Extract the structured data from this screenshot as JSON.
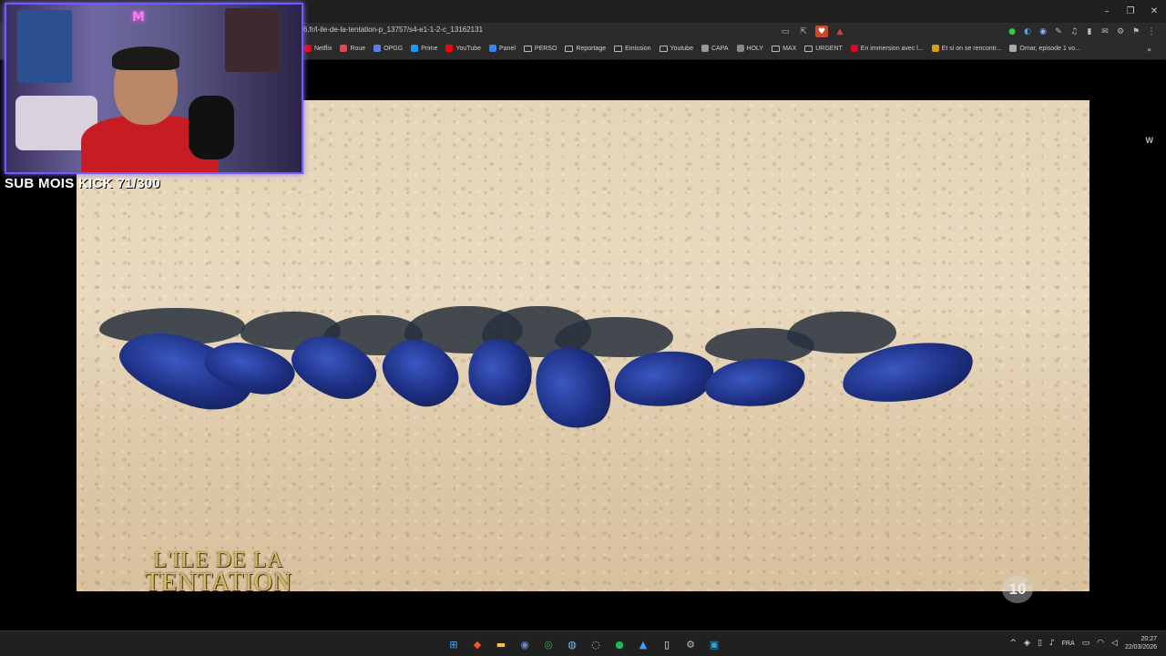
{
  "browser": {
    "url": "6.fr/l-ile-de-la-tentation-p_13757/s4-e1-1-2-c_13162131",
    "window_controls": {
      "minimize": "–",
      "restore": "❐",
      "close": "✕"
    },
    "address_icons": [
      "▭",
      "⇱",
      "♥",
      "▲"
    ],
    "extension_icons": [
      "●",
      "◐",
      "◉",
      "✎",
      "♫",
      "▮",
      "✉",
      "⚙",
      "⚑",
      "⋮"
    ],
    "bookmarks": [
      {
        "label": "Netflix",
        "color": "#e50914",
        "type": "site"
      },
      {
        "label": "Roue",
        "color": "#e04a4a",
        "type": "site"
      },
      {
        "label": "OPGG",
        "color": "#5383e8",
        "type": "site"
      },
      {
        "label": "Prime",
        "color": "#1a98ff",
        "type": "site"
      },
      {
        "label": "YouTube",
        "color": "#ff0000",
        "type": "site"
      },
      {
        "label": "Panel",
        "color": "#3b82f6",
        "type": "site"
      },
      {
        "label": "PERSO",
        "type": "folder"
      },
      {
        "label": "Reportage",
        "type": "folder"
      },
      {
        "label": "Emission",
        "type": "folder"
      },
      {
        "label": "Youtube",
        "type": "folder"
      },
      {
        "label": "CAPA",
        "color": "#999999",
        "type": "site"
      },
      {
        "label": "HOLY",
        "color": "#888888",
        "type": "site"
      },
      {
        "label": "MAX",
        "type": "folder"
      },
      {
        "label": "URGENT",
        "type": "folder"
      },
      {
        "label": "En immersion avec l...",
        "color": "#e5002b",
        "type": "site"
      },
      {
        "label": "Et si on se rencontr...",
        "color": "#d4a017",
        "type": "site"
      },
      {
        "label": "Omar, episode 1 vo...",
        "color": "#aaaaaa",
        "type": "site"
      }
    ],
    "more_bookmarks": "»"
  },
  "video": {
    "corner_watermark": "W",
    "show_logo_line1": "L'ILE DE LA",
    "show_logo_line2": "TENTATION",
    "channel_logo": "10"
  },
  "webcam": {
    "neon_text": "M",
    "sub_counter": "SUB MOIS KICK 71/300"
  },
  "taskbar": {
    "apps": [
      {
        "name": "windows-start-icon",
        "glyph": "⊞",
        "color": "#4ea3ff"
      },
      {
        "name": "brave-browser-icon",
        "glyph": "◆",
        "color": "#fb542b"
      },
      {
        "name": "file-explorer-icon",
        "glyph": "▬",
        "color": "#f5c542"
      },
      {
        "name": "discord-icon",
        "glyph": "◉",
        "color": "#7289da"
      },
      {
        "name": "chrome-icon",
        "glyph": "◎",
        "color": "#34a853"
      },
      {
        "name": "steam-icon",
        "glyph": "◍",
        "color": "#66c0f4"
      },
      {
        "name": "obs-icon",
        "glyph": "◌",
        "color": "#cccccc"
      },
      {
        "name": "spotify-icon",
        "glyph": "●",
        "color": "#1db954"
      },
      {
        "name": "photos-icon",
        "glyph": "▲",
        "color": "#3aa0ff"
      },
      {
        "name": "notepad-icon",
        "glyph": "▯",
        "color": "#eeeeee"
      },
      {
        "name": "settings-icon",
        "glyph": "⚙",
        "color": "#bbbbbb"
      },
      {
        "name": "app-icon",
        "glyph": "▣",
        "color": "#29a8e0"
      }
    ],
    "tray": {
      "chevron": "^",
      "language": "FRA",
      "time": "20:27",
      "date": "22/03/2026"
    }
  }
}
